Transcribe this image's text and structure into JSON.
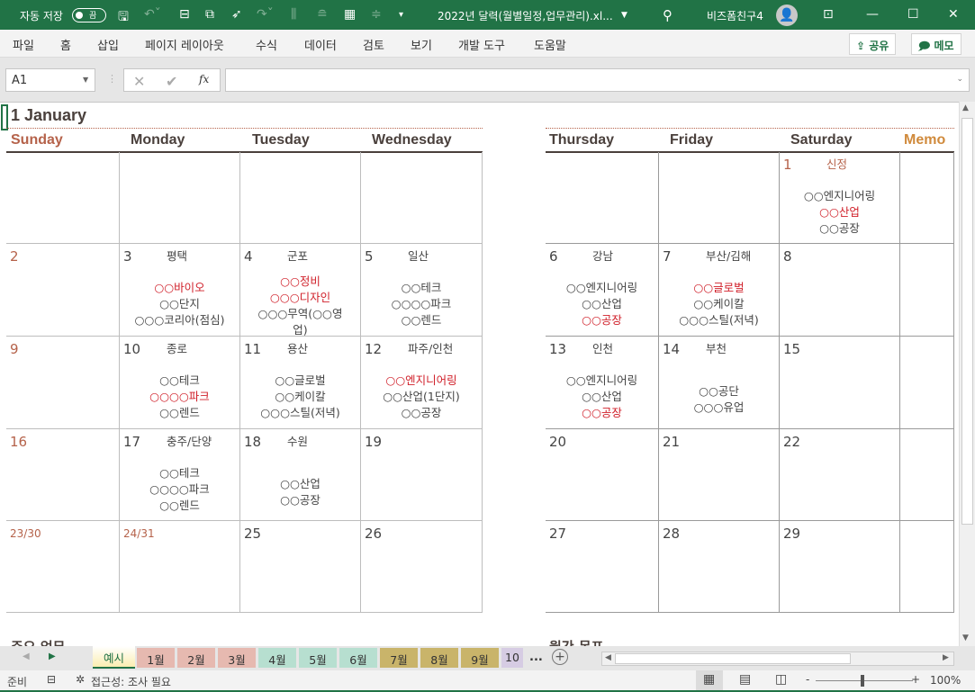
{
  "titlebar": {
    "autosave_label": "자동 저장",
    "autosave_state": "끔",
    "filename": "2022년 달력(월별일정,업무관리).xl...",
    "user": "비즈폼친구4"
  },
  "ribbon": {
    "tabs": [
      "파일",
      "홈",
      "삽입",
      "페이지 레이아웃",
      "수식",
      "데이터",
      "검토",
      "보기",
      "개발 도구",
      "도움말"
    ],
    "share": "공유",
    "comment": "메모"
  },
  "formula": {
    "name_box": "A1",
    "fx": "fx",
    "value": ""
  },
  "calendar": {
    "title": "1 January",
    "headers": [
      "Sunday",
      "Monday",
      "Tuesday",
      "Wednesday",
      "Thursday",
      "Friday",
      "Saturday",
      "Memo"
    ],
    "colors": {
      "sunday": "#b5624a",
      "memo": "#d08a3c",
      "red": "#d0202a"
    },
    "weeks": [
      [
        {},
        {},
        {},
        {},
        {},
        {},
        {
          "day": "1",
          "place": "신정",
          "holiday": true,
          "items": [
            {
              "t": "○○엔지니어링"
            },
            {
              "t": "○○산업",
              "red": true
            },
            {
              "t": "○○공장"
            }
          ]
        },
        {}
      ],
      [
        {
          "day": "2",
          "sun": true
        },
        {
          "day": "3",
          "place": "평택",
          "items": [
            {
              "t": "○○바이오",
              "red": true
            },
            {
              "t": "○○단지"
            },
            {
              "t": "○○○코리아(점심)"
            }
          ]
        },
        {
          "day": "4",
          "place": "군포",
          "items": [
            {
              "t": "○○정비",
              "red": true
            },
            {
              "t": "○○○디자인",
              "red": true
            },
            {
              "t": "○○○무역(○○영"
            },
            {
              "t": "업)"
            }
          ]
        },
        {
          "day": "5",
          "place": "일산",
          "items": [
            {
              "t": "○○테크"
            },
            {
              "t": "○○○○파크"
            },
            {
              "t": "○○렌드"
            }
          ]
        },
        {
          "day": "6",
          "place": "강남",
          "items": [
            {
              "t": "○○엔지니어링"
            },
            {
              "t": "○○산업"
            },
            {
              "t": "○○공장",
              "red": true
            }
          ]
        },
        {
          "day": "7",
          "place": "부산/김해",
          "items": [
            {
              "t": "○○글로벌",
              "red": true
            },
            {
              "t": "○○케이칼"
            },
            {
              "t": "○○○스틸(저녁)"
            }
          ]
        },
        {
          "day": "8"
        },
        {}
      ],
      [
        {
          "day": "9",
          "sun": true
        },
        {
          "day": "10",
          "place": "종로",
          "items": [
            {
              "t": "○○테크"
            },
            {
              "t": "○○○○파크",
              "red": true
            },
            {
              "t": "○○렌드"
            }
          ]
        },
        {
          "day": "11",
          "place": "용산",
          "items": [
            {
              "t": "○○글로벌"
            },
            {
              "t": "○○케이칼"
            },
            {
              "t": "○○○스틸(저녁)"
            }
          ]
        },
        {
          "day": "12",
          "place": "파주/인천",
          "items": [
            {
              "t": "○○엔지니어링",
              "red": true
            },
            {
              "t": "○○산업(1단지)"
            },
            {
              "t": "○○공장"
            }
          ]
        },
        {
          "day": "13",
          "place": "인천",
          "items": [
            {
              "t": "○○엔지니어링"
            },
            {
              "t": "○○산업"
            },
            {
              "t": "○○공장",
              "red": true
            }
          ]
        },
        {
          "day": "14",
          "place": "부천",
          "items": [
            {
              "t": "○○공단"
            },
            {
              "t": "○○○유업"
            }
          ]
        },
        {
          "day": "15"
        },
        {}
      ],
      [
        {
          "day": "16",
          "sun": true
        },
        {
          "day": "17",
          "place": "충주/단양",
          "items": [
            {
              "t": "○○테크"
            },
            {
              "t": "○○○○파크"
            },
            {
              "t": "○○렌드"
            }
          ]
        },
        {
          "day": "18",
          "place": "수원",
          "items": [
            {
              "t": "○○산업"
            },
            {
              "t": "○○공장"
            }
          ]
        },
        {
          "day": "19"
        },
        {
          "day": "20"
        },
        {
          "day": "21"
        },
        {
          "day": "22"
        },
        {}
      ],
      [
        {
          "day": "23/30",
          "sun": true,
          "small": true
        },
        {
          "day": "24/31",
          "sun": true,
          "small": true
        },
        {
          "day": "25"
        },
        {
          "day": "26"
        },
        {
          "day": "27"
        },
        {
          "day": "28"
        },
        {
          "day": "29"
        },
        {}
      ]
    ],
    "bottom_left": "주요 업무",
    "bottom_right": "월간 목표"
  },
  "sheet_tabs": [
    {
      "label": "예시",
      "color": "#fbeeb0"
    },
    {
      "label": "1월",
      "color": "#e6b9b0"
    },
    {
      "label": "2월",
      "color": "#e6b9b0"
    },
    {
      "label": "3월",
      "color": "#e6b9b0"
    },
    {
      "label": "4월",
      "color": "#b7dfd0"
    },
    {
      "label": "5월",
      "color": "#b7dfd0"
    },
    {
      "label": "6월",
      "color": "#b7dfd0"
    },
    {
      "label": "7월",
      "color": "#c9b46a"
    },
    {
      "label": "8월",
      "color": "#c9b46a"
    },
    {
      "label": "9월",
      "color": "#c9b46a"
    },
    {
      "label": "10",
      "color": "#d6cce3"
    }
  ],
  "sheet_tabs_more": "...",
  "status": {
    "ready": "준비",
    "accessibility": "접근성: 조사 필요",
    "zoom": "100%",
    "zoom_minus": "-",
    "zoom_plus": "+"
  }
}
